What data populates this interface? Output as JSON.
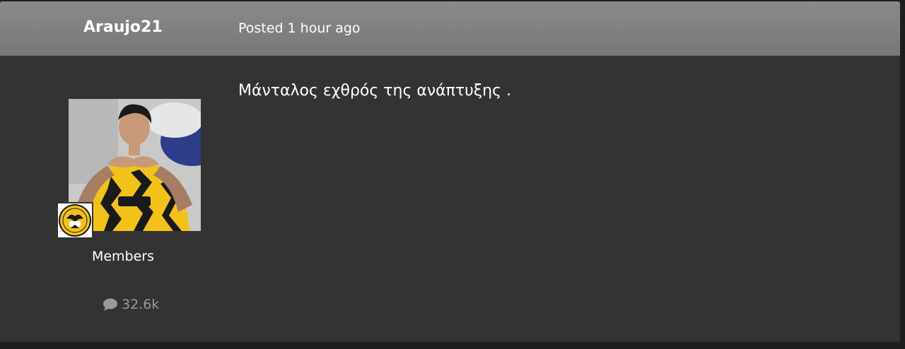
{
  "post": {
    "author": "Araujo21",
    "posted": "Posted 1 hour ago",
    "content": "Μάνταλος εχθρός της ανάπτυξης .",
    "group": "Members",
    "post_count": "32.6k"
  },
  "colors": {
    "header_bg": "#808080",
    "body_bg": "#333333",
    "jersey_yellow": "#f2c21b",
    "muted_text": "#9a9a9a"
  },
  "icons": {
    "post_count_icon": "speech-bubble-icon"
  }
}
